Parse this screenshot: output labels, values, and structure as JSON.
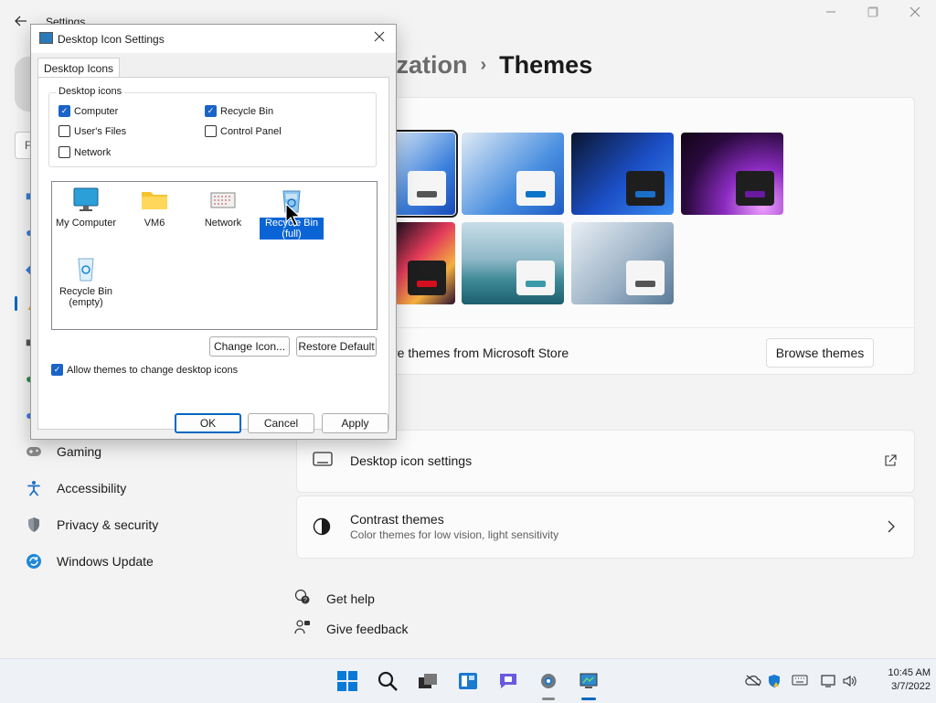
{
  "settings": {
    "app_title": "Settings",
    "breadcrumb": {
      "parent": "ization",
      "separator": "›",
      "current": "Themes"
    },
    "search_partial": "F",
    "themes": [
      {
        "bg": "linear-gradient(135deg,#cfe2f5,#3b7fdc 60%,#1a49b8)",
        "mini_bg": "#f5f5f5",
        "bar": "#555555"
      },
      {
        "bg": "linear-gradient(135deg,#dfeaf4,#4a8fe0 60%,#1d5cc4)",
        "mini_bg": "#f5f5f5",
        "bar": "#0a74c8"
      },
      {
        "bg": "linear-gradient(135deg,#0a1630,#1c4fc8 55%,#3a8cf0)",
        "mini_bg": "#1e1e1e",
        "bar": "#1a6fc9"
      },
      {
        "bg": "radial-gradient(circle at 80% 90%,#f0a0ff,#8a2bbf 35%,#2a0a3e 70%,#120414)",
        "mini_bg": "#1e1e1e",
        "bar": "#6a1aa0"
      },
      {
        "bg": "linear-gradient(135deg,#1a1020,#e23a5a 40%,#f4b040 70%,#2a1030)",
        "mini_bg": "#1e1e1e",
        "bar": "#d4101e"
      },
      {
        "bg": "linear-gradient(180deg,#c8dde8,#8fb8c8 45%,#3f8a98 70%,#1d5f6e)",
        "mini_bg": "#f5f5f5",
        "bar": "#3a9aaa"
      },
      {
        "bg": "linear-gradient(135deg,#e8eef4,#9fb4c8 55%,#5a7a98)",
        "mini_bg": "#f5f5f5",
        "bar": "#555555"
      }
    ],
    "store_text": "re themes from Microsoft Store",
    "browse_button": "Browse themes",
    "desktop_icon_settings": "Desktop icon settings",
    "contrast": {
      "title": "Contrast themes",
      "subtitle": "Color themes for low vision, light sensitivity"
    },
    "nav": [
      {
        "label": "Gaming",
        "icon": "gaming-icon"
      },
      {
        "label": "Accessibility",
        "icon": "accessibility-icon"
      },
      {
        "label": "Privacy & security",
        "icon": "shield-icon"
      },
      {
        "label": "Windows Update",
        "icon": "windows-update-icon"
      }
    ],
    "get_help": "Get help",
    "give_feedback": "Give feedback"
  },
  "dialog": {
    "title": "Desktop Icon Settings",
    "tab": "Desktop Icons",
    "group_label": "Desktop icons",
    "checkboxes": [
      {
        "label": "Computer",
        "checked": true
      },
      {
        "label": "Recycle Bin",
        "checked": true
      },
      {
        "label": "User's Files",
        "checked": false
      },
      {
        "label": "Control Panel",
        "checked": false
      },
      {
        "label": "Network",
        "checked": false
      }
    ],
    "icons": [
      {
        "label": "My Computer",
        "kind": "monitor"
      },
      {
        "label": "VM6",
        "kind": "folder"
      },
      {
        "label": "Network",
        "kind": "network"
      },
      {
        "label": "Recycle Bin\n(full)",
        "kind": "bin-full",
        "selected": true
      },
      {
        "label": "Recycle Bin\n(empty)",
        "kind": "bin-empty"
      }
    ],
    "change_icon": "Change Icon...",
    "restore_default": "Restore Default",
    "allow_themes": "Allow themes to change desktop icons",
    "allow_themes_checked": true,
    "ok": "OK",
    "cancel": "Cancel",
    "apply": "Apply"
  },
  "taskbar": {
    "time": "10:45 AM",
    "date": "3/7/2022",
    "accent": "#0067c0"
  }
}
